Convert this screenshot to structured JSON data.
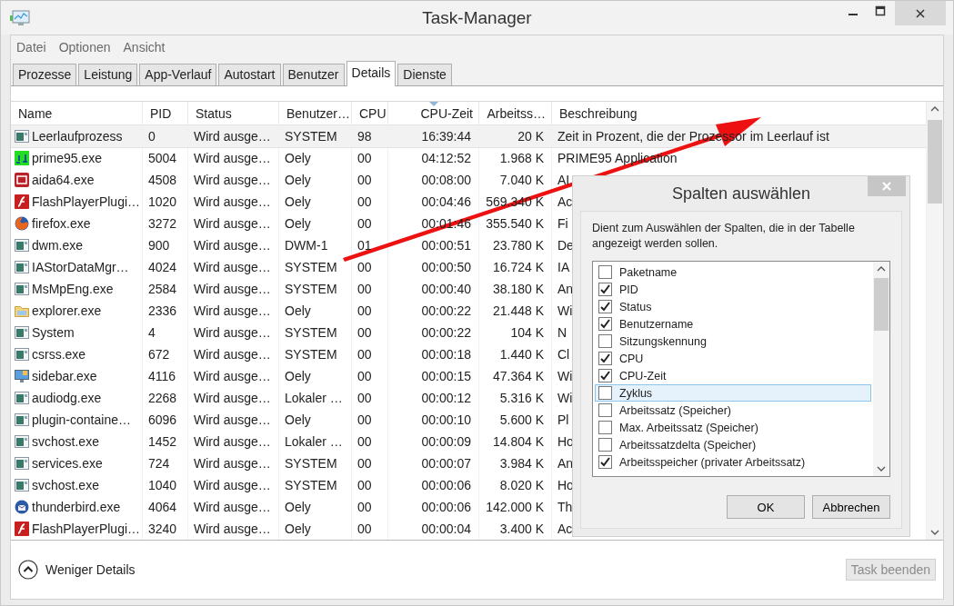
{
  "window": {
    "title": "Task-Manager"
  },
  "menu": [
    "Datei",
    "Optionen",
    "Ansicht"
  ],
  "tabs": [
    {
      "label": "Prozesse",
      "selected": false
    },
    {
      "label": "Leistung",
      "selected": false
    },
    {
      "label": "App-Verlauf",
      "selected": false
    },
    {
      "label": "Autostart",
      "selected": false
    },
    {
      "label": "Benutzer",
      "selected": false
    },
    {
      "label": "Details",
      "selected": true
    },
    {
      "label": "Dienste",
      "selected": false
    }
  ],
  "table": {
    "columns": [
      {
        "label": "Name",
        "sorted": false
      },
      {
        "label": "PID",
        "sorted": false
      },
      {
        "label": "Status",
        "sorted": false
      },
      {
        "label": "Benutzer…",
        "sorted": false
      },
      {
        "label": "CPU",
        "sorted": false
      },
      {
        "label": "CPU-Zeit",
        "sorted": true
      },
      {
        "label": "Arbeitss…",
        "sorted": false
      },
      {
        "label": "Beschreibung",
        "sorted": false
      }
    ],
    "rows": [
      {
        "kind": "window",
        "selected": true,
        "cells": [
          "Leerlaufprozess",
          "0",
          "Wird ausge…",
          "SYSTEM",
          "98",
          "16:39:44",
          "20 K",
          "Zeit in Prozent, die der Prozessor im Leerlauf ist"
        ]
      },
      {
        "kind": "prime",
        "selected": false,
        "cells": [
          "prime95.exe",
          "5004",
          "Wird ausge…",
          "Oely",
          "00",
          "04:12:52",
          "1.968 K",
          "PRIME95 Application"
        ]
      },
      {
        "kind": "aida",
        "selected": false,
        "cells": [
          "aida64.exe",
          "4508",
          "Wird ausge…",
          "Oely",
          "00",
          "00:08:00",
          "7.040 K",
          "AI"
        ]
      },
      {
        "kind": "flash",
        "selected": false,
        "cells": [
          "FlashPlayerPlugi…",
          "1020",
          "Wird ausge…",
          "Oely",
          "00",
          "00:04:46",
          "569.340 K",
          "Ac"
        ]
      },
      {
        "kind": "firefox",
        "selected": false,
        "cells": [
          "firefox.exe",
          "3272",
          "Wird ausge…",
          "Oely",
          "00",
          "00:01:46",
          "355.540 K",
          "Fi"
        ]
      },
      {
        "kind": "window",
        "selected": false,
        "cells": [
          "dwm.exe",
          "900",
          "Wird ausge…",
          "DWM-1",
          "01",
          "00:00:51",
          "23.780 K",
          "De"
        ]
      },
      {
        "kind": "window",
        "selected": false,
        "cells": [
          "IAStorDataMgr…",
          "4024",
          "Wird ausge…",
          "SYSTEM",
          "00",
          "00:00:50",
          "16.724 K",
          "IA"
        ]
      },
      {
        "kind": "window",
        "selected": false,
        "cells": [
          "MsMpEng.exe",
          "2584",
          "Wird ausge…",
          "SYSTEM",
          "00",
          "00:00:40",
          "38.180 K",
          "An"
        ]
      },
      {
        "kind": "folder",
        "selected": false,
        "cells": [
          "explorer.exe",
          "2336",
          "Wird ausge…",
          "Oely",
          "00",
          "00:00:22",
          "21.448 K",
          "Wi"
        ]
      },
      {
        "kind": "window",
        "selected": false,
        "cells": [
          "System",
          "4",
          "Wird ausge…",
          "SYSTEM",
          "00",
          "00:00:22",
          "104 K",
          "N"
        ]
      },
      {
        "kind": "window",
        "selected": false,
        "cells": [
          "csrss.exe",
          "672",
          "Wird ausge…",
          "SYSTEM",
          "00",
          "00:00:18",
          "1.440 K",
          "Cl"
        ]
      },
      {
        "kind": "monitor",
        "selected": false,
        "cells": [
          "sidebar.exe",
          "4116",
          "Wird ausge…",
          "Oely",
          "00",
          "00:00:15",
          "47.364 K",
          "Wi"
        ]
      },
      {
        "kind": "window",
        "selected": false,
        "cells": [
          "audiodg.exe",
          "2268",
          "Wird ausge…",
          "Lokaler …",
          "00",
          "00:00:12",
          "5.316 K",
          "Wi"
        ]
      },
      {
        "kind": "window",
        "selected": false,
        "cells": [
          "plugin-containe…",
          "6096",
          "Wird ausge…",
          "Oely",
          "00",
          "00:00:10",
          "5.600 K",
          "Pl"
        ]
      },
      {
        "kind": "window",
        "selected": false,
        "cells": [
          "svchost.exe",
          "1452",
          "Wird ausge…",
          "Lokaler …",
          "00",
          "00:00:09",
          "14.804 K",
          "Ho"
        ]
      },
      {
        "kind": "window",
        "selected": false,
        "cells": [
          "services.exe",
          "724",
          "Wird ausge…",
          "SYSTEM",
          "00",
          "00:00:07",
          "3.984 K",
          "An"
        ]
      },
      {
        "kind": "window",
        "selected": false,
        "cells": [
          "svchost.exe",
          "1040",
          "Wird ausge…",
          "SYSTEM",
          "00",
          "00:00:06",
          "8.020 K",
          "Ho"
        ]
      },
      {
        "kind": "thunderbird",
        "selected": false,
        "cells": [
          "thunderbird.exe",
          "4064",
          "Wird ausge…",
          "Oely",
          "00",
          "00:00:06",
          "142.000 K",
          "Th"
        ]
      },
      {
        "kind": "flash",
        "selected": false,
        "cells": [
          "FlashPlayerPlugi…",
          "3240",
          "Wird ausge…",
          "Oely",
          "00",
          "00:00:04",
          "3.400 K",
          "Ac"
        ]
      }
    ]
  },
  "footer": {
    "toggle": "Weniger Details",
    "end_task": {
      "label": "Task beenden",
      "disabled": true
    }
  },
  "dialog": {
    "title": "Spalten auswählen",
    "description": "Dient zum Auswählen der Spalten, die in der Tabelle angezeigt werden sollen.",
    "items": [
      {
        "label": "Paketname",
        "checked": false,
        "selected": false
      },
      {
        "label": "PID",
        "checked": true,
        "selected": false
      },
      {
        "label": "Status",
        "checked": true,
        "selected": false
      },
      {
        "label": "Benutzername",
        "checked": true,
        "selected": false
      },
      {
        "label": "Sitzungskennung",
        "checked": false,
        "selected": false
      },
      {
        "label": "CPU",
        "checked": true,
        "selected": false
      },
      {
        "label": "CPU-Zeit",
        "checked": true,
        "selected": false
      },
      {
        "label": "Zyklus",
        "checked": false,
        "selected": true
      },
      {
        "label": "Arbeitssatz (Speicher)",
        "checked": false,
        "selected": false
      },
      {
        "label": "Max. Arbeitssatz (Speicher)",
        "checked": false,
        "selected": false
      },
      {
        "label": "Arbeitssatzdelta (Speicher)",
        "checked": false,
        "selected": false
      },
      {
        "label": "Arbeitsspeicher (privater Arbeitssatz)",
        "checked": true,
        "selected": false
      }
    ],
    "buttons": [
      "OK",
      "Abbrechen"
    ]
  }
}
